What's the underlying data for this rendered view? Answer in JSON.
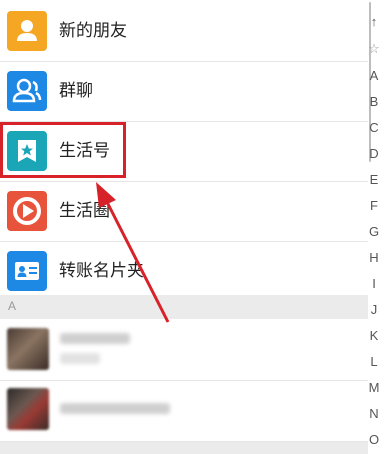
{
  "contacts_menu": {
    "items": [
      {
        "label": "新的朋友",
        "icon": "person-icon",
        "color": "#f5a623"
      },
      {
        "label": "群聊",
        "icon": "group-icon",
        "color": "#1e88e5"
      },
      {
        "label": "生活号",
        "icon": "bookmark-star-icon",
        "color": "#1aa6b7"
      },
      {
        "label": "生活圈",
        "icon": "circle-play-icon",
        "color": "#e8543b"
      },
      {
        "label": "转账名片夹",
        "icon": "card-icon",
        "color": "#1e88e5"
      }
    ]
  },
  "section_header": "A",
  "index_bar": [
    "↑",
    "☆",
    "A",
    "B",
    "C",
    "D",
    "E",
    "F",
    "G",
    "H",
    "I",
    "J",
    "K",
    "L",
    "M",
    "N",
    "O"
  ],
  "annotation": {
    "highlight_color": "#d8222a"
  }
}
